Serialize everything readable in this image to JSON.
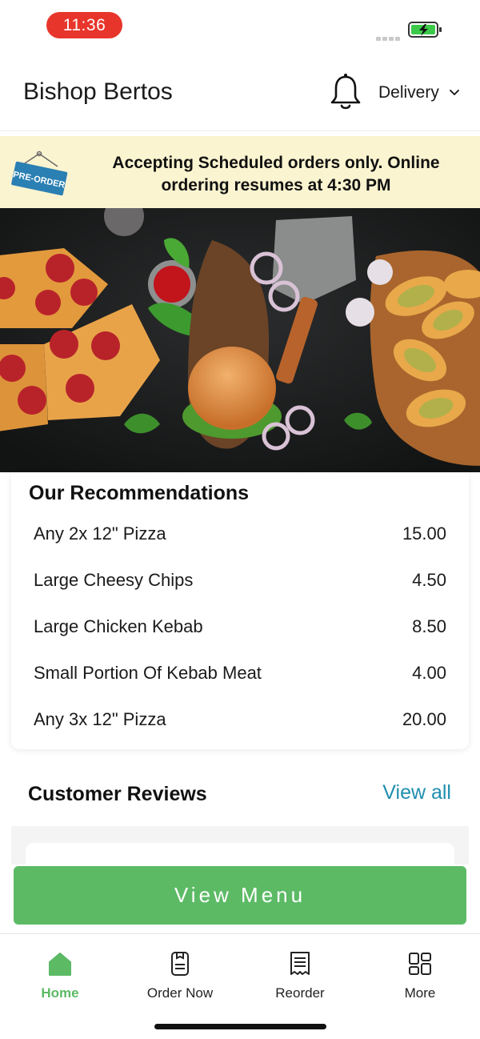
{
  "status_bar": {
    "time": "11:36"
  },
  "header": {
    "store_name": "Bishop Bertos",
    "mode_label": "Delivery"
  },
  "banner": {
    "tag_label": "PRE-ORDER",
    "message": "Accepting Scheduled orders only. Online ordering resumes at 4:30 PM"
  },
  "recommendations": {
    "title": "Our Recommendations",
    "items": [
      {
        "name": "Any 2x 12\" Pizza",
        "price": "15.00"
      },
      {
        "name": "Large Cheesy Chips",
        "price": "4.50"
      },
      {
        "name": "Large Chicken Kebab",
        "price": "8.50"
      },
      {
        "name": "Small Portion Of Kebab Meat",
        "price": "4.00"
      },
      {
        "name": "Any 3x 12\" Pizza",
        "price": "20.00"
      }
    ]
  },
  "reviews": {
    "title": "Customer Reviews",
    "view_all_label": "View all"
  },
  "cta": {
    "label": "View Menu"
  },
  "bottom_nav": {
    "items": [
      {
        "label": "Home",
        "icon": "home-icon",
        "active": true
      },
      {
        "label": "Order Now",
        "icon": "order-icon",
        "active": false
      },
      {
        "label": "Reorder",
        "icon": "receipt-icon",
        "active": false
      },
      {
        "label": "More",
        "icon": "grid-icon",
        "active": false
      }
    ]
  },
  "colors": {
    "status_pill": "#e8352b",
    "banner_bg": "#fbf4d0",
    "accent_green": "#5cba65",
    "link_blue": "#1f8fb0"
  }
}
